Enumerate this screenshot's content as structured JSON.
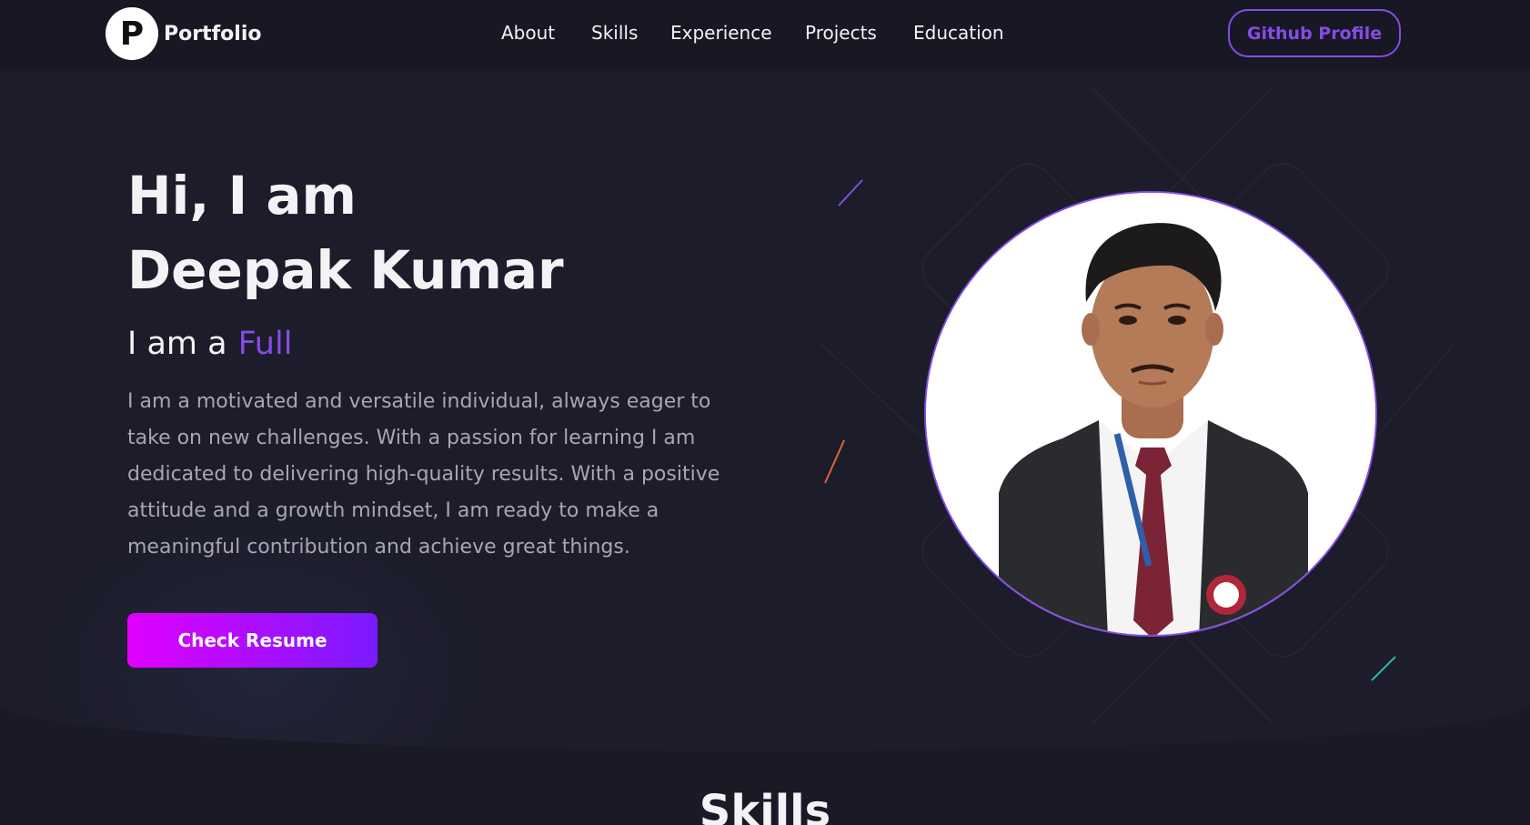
{
  "nav": {
    "logo_letter": "P",
    "logo_text": "Portfolio",
    "links": [
      "About",
      "Skills",
      "Experience",
      "Projects",
      "Education"
    ],
    "github_label": "Github Profile"
  },
  "hero": {
    "greeting_line1": "Hi, I am",
    "name": "Deepak Kumar",
    "role_prefix": "I am a",
    "role_value": "Full",
    "bio": "I am a motivated and versatile individual, always eager to take on new challenges. With a passion for learning I am dedicated to delivering high-quality results. With a positive attitude and a growth mindset, I am ready to make a meaningful contribution and achieve great things.",
    "resume_label": "Check Resume"
  },
  "skills": {
    "title": "Skills"
  },
  "colors": {
    "background": "#1a1a26",
    "accent": "#854ce6",
    "text": "#f2f3f4",
    "text_secondary": "#a7a7b1",
    "button_gradient_start": "#e100ff",
    "button_gradient_end": "#7a1aff"
  },
  "icons": [
    "logo-icon",
    "profile-photo"
  ]
}
